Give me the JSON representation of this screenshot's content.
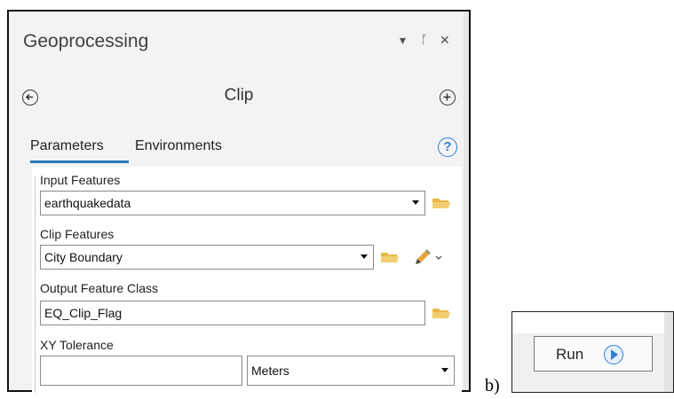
{
  "panel": {
    "title": "Geoprocessing",
    "title_controls": {
      "dropdown": "▾",
      "pin": "ᚪ",
      "close": "✕"
    },
    "tool_name": "Clip",
    "tabs": [
      {
        "label": "Parameters",
        "active": true
      },
      {
        "label": "Environments",
        "active": false
      }
    ],
    "help_symbol": "?"
  },
  "parameters": {
    "input_features": {
      "label": "Input Features",
      "value": "earthquakedata"
    },
    "clip_features": {
      "label": "Clip Features",
      "value": "City Boundary"
    },
    "output_feature_class": {
      "label": "Output Feature Class",
      "value": "EQ_Clip_Flag"
    },
    "xy_tolerance": {
      "label": "XY Tolerance",
      "value": "",
      "unit": "Meters"
    }
  },
  "b_label": "b)",
  "run_button": {
    "label": "Run"
  },
  "icons": {
    "back": "back-circle-icon",
    "add": "add-circle-icon",
    "folder": "folder-icon",
    "pencil": "pencil-icon",
    "help": "help-icon",
    "play": "play-icon"
  },
  "colors": {
    "accent": "#2f80d0",
    "folder": "#e6b84a",
    "panel_bg": "#f3f3f3"
  }
}
